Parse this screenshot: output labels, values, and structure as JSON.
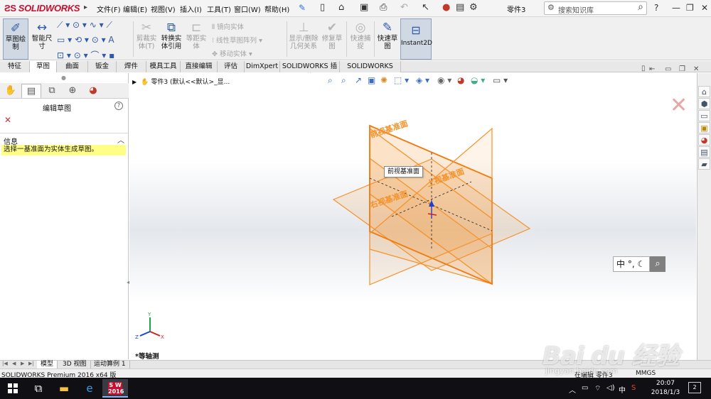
{
  "app": {
    "logo_text": "SOLIDWORKS",
    "document_title": "零件3"
  },
  "menu": {
    "items": [
      "文件(F)",
      "编辑(E)",
      "视图(V)",
      "插入(I)",
      "工具(T)",
      "窗口(W)",
      "帮助(H)"
    ]
  },
  "search": {
    "placeholder": "搜索知识库"
  },
  "command_manager": {
    "sketch": "草图绘\n制",
    "smart_dim": "智能尺\n寸",
    "trim": "剪裁实\n体(T)",
    "convert": "转换实\n体引用",
    "offset": "等距实\n体",
    "mirror": "镜向实体",
    "linear_pattern": "线性草图阵列",
    "move": "移动实体",
    "display_relations": "显示/删除\n几何关系",
    "repair": "修复草\n图",
    "quick_snaps": "快速捕\n捉",
    "rapid_sketch": "快速草\n图",
    "instant2d": "Instant2D"
  },
  "tabs": [
    {
      "label": "特征",
      "active": false
    },
    {
      "label": "草图",
      "active": true
    },
    {
      "label": "曲面",
      "active": false
    },
    {
      "label": "钣金",
      "active": false
    },
    {
      "label": "焊件",
      "active": false
    },
    {
      "label": "模具工具",
      "active": false
    },
    {
      "label": "直接编辑",
      "active": false
    },
    {
      "label": "评估",
      "active": false
    },
    {
      "label": "DimXpert",
      "active": false
    },
    {
      "label": "SOLIDWORKS 插件",
      "active": false
    },
    {
      "label": "SOLIDWORKS MBD",
      "active": false
    }
  ],
  "property_manager": {
    "title": "编辑草图",
    "help": "?",
    "info_heading": "信息",
    "info_message": "选择一基准面为实体生成草图。"
  },
  "viewport": {
    "tree_text": "零件3  (默认<<默认>_显...",
    "tooltip": "前视基准面",
    "plane_front": "前视基准面",
    "plane_right": "右视基准面",
    "plane_top": "上视基准面",
    "view_name": "*等轴测",
    "ime_text": "中 °,",
    "axis_x": "X",
    "axis_y": "Y",
    "axis_z": "Z"
  },
  "bottom_tabs": [
    {
      "label": "模型",
      "active": true
    },
    {
      "label": "3D 视图",
      "active": false
    },
    {
      "label": "运动算例 1",
      "active": false
    }
  ],
  "status": {
    "left": "SOLIDWORKS Premium 2016 x64 版",
    "editing": "在编辑 零件3",
    "units": "MMGS"
  },
  "taskbar": {
    "time": "20:07",
    "date": "2018/1/3",
    "ime": "中",
    "notification_count": "2",
    "sw_badge_line1": "S W",
    "sw_badge_line2": "2016"
  },
  "watermark": {
    "main": "Bai du 经验",
    "sub": "jingyan.baidu.com"
  },
  "colors": {
    "plane_orange": "#f5922a",
    "selection_yellow": "#ffff88",
    "brand_red": "#c8102e",
    "taskbar_bg": "#101014"
  }
}
